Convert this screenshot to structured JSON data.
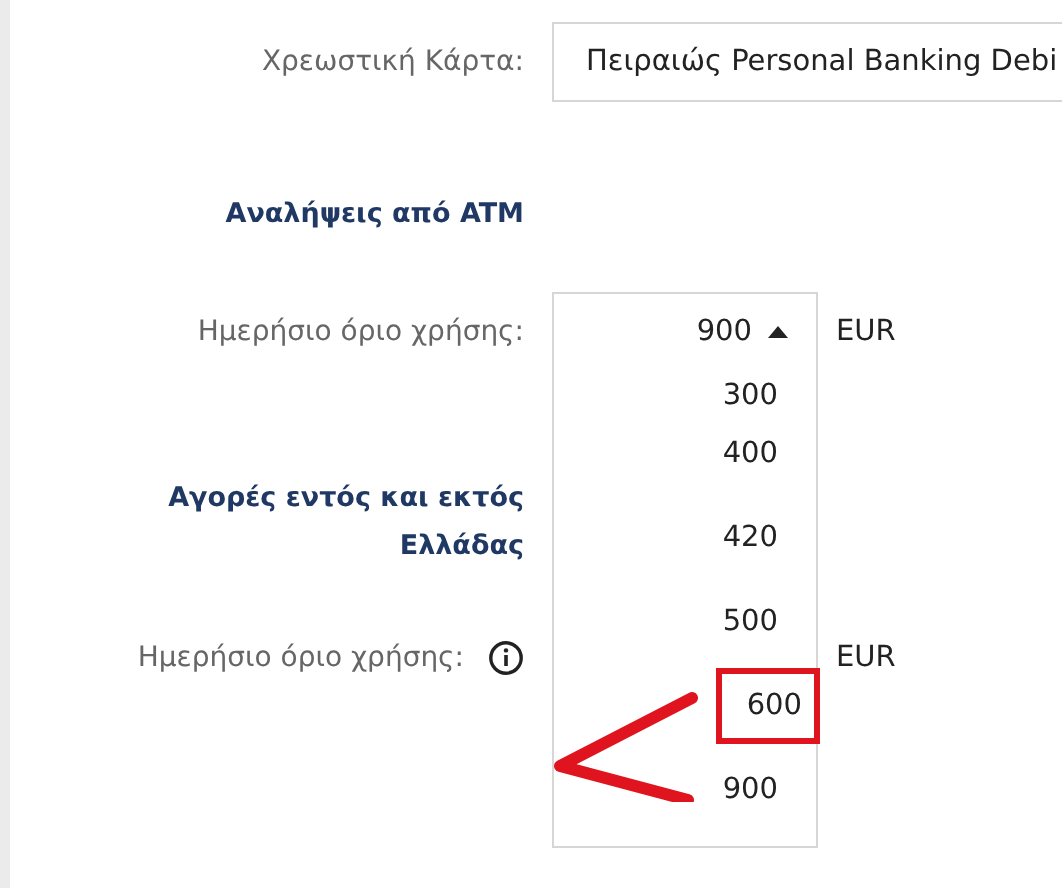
{
  "card_row": {
    "label": "Χρεωστική Κάρτα:",
    "value": "Πειραιώς Personal Banking Debi"
  },
  "atm_section": {
    "heading": "Αναλήψεις από ATM",
    "limit_label": "Ημερήσιο όριο χρήσης:",
    "value": "900",
    "currency": "EUR",
    "expanded": true,
    "options": [
      {
        "label": "300",
        "highlighted": false
      },
      {
        "label": "400",
        "highlighted": false
      },
      {
        "label": "420",
        "highlighted": false
      },
      {
        "label": "500",
        "highlighted": false
      },
      {
        "label": "600",
        "highlighted": true
      },
      {
        "label": "900",
        "highlighted": false
      }
    ]
  },
  "purchases_section": {
    "heading": "Αγορές εντός και εκτός Ελλάδας",
    "limit_label": "Ημερήσιο όριο χρήσης:",
    "currency": "EUR"
  }
}
